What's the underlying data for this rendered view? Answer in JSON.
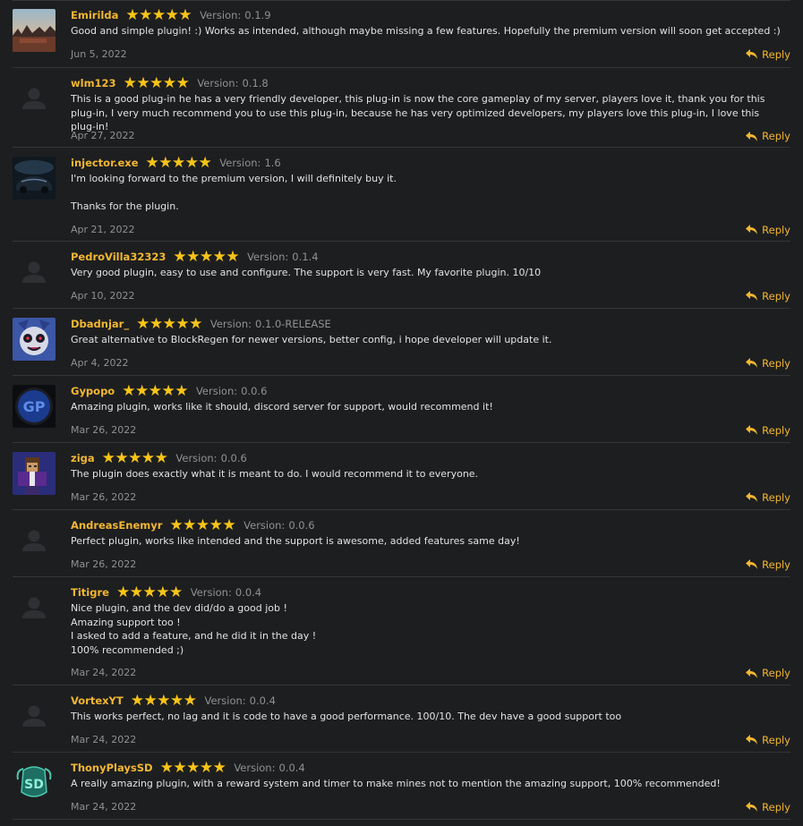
{
  "colors": {
    "background": "#1d1e20",
    "author": "#f2b731",
    "star": "#f7c417",
    "muted": "#8f9193",
    "divider": "#343638"
  },
  "version_label": "Version:",
  "reply_label": "Reply",
  "reviews": [
    {
      "author": "Emirilda",
      "rating": 5,
      "version": "0.1.9",
      "text": "Good and simple plugin! :) Works as intended, although maybe missing a few features. Hopefully the premium version will soon get accepted :)",
      "date": "Jun 5, 2022",
      "avatar": "landscape-photo"
    },
    {
      "author": "wlm123",
      "rating": 5,
      "version": "0.1.8",
      "text": "This is a good plug-in he has a very friendly developer, this plug-in is now the core gameplay of my server, players love it, thank you for this plug-in, I very much recommend you to use this plug-in, because he has very optimized developers, my players love this plug-in, I love this plug-in!",
      "date": "Apr 27, 2022",
      "avatar": "default-user"
    },
    {
      "author": "injector.exe",
      "rating": 5,
      "version": "1.6",
      "text": "I'm looking forward to the premium version, I will definitely buy it.\n\nThanks for the plugin.",
      "date": "Apr 21, 2022",
      "avatar": "dark-car"
    },
    {
      "author": "PedroVilla32323",
      "rating": 5,
      "version": "0.1.4",
      "text": "Very good plugin, easy to use and configure. The support is very fast. My favorite plugin. 10/10",
      "date": "Apr 10, 2022",
      "avatar": "default-user"
    },
    {
      "author": "Dbadnjar_",
      "rating": 5,
      "version": "0.1.0-RELEASE",
      "text": "Great alternative to BlockRegen for newer versions, better config, i hope developer will update it.",
      "date": "Apr 4, 2022",
      "avatar": "cartoon-face"
    },
    {
      "author": "Gypopo",
      "rating": 5,
      "version": "0.0.6",
      "text": "Amazing plugin, works like it should, discord server for support, would recommend it!",
      "date": "Mar 26, 2022",
      "avatar": "gp-logo"
    },
    {
      "author": "ziga",
      "rating": 5,
      "version": "0.0.6",
      "text": "The plugin does exactly what it is meant to do. I would recommend it to everyone.",
      "date": "Mar 26, 2022",
      "avatar": "minecraft-skin"
    },
    {
      "author": "AndreasEnemyr",
      "rating": 5,
      "version": "0.0.6",
      "text": "Perfect plugin, works like intended and the support is awesome, added features same day!",
      "date": "Mar 26, 2022",
      "avatar": "default-user"
    },
    {
      "author": "Titigre",
      "rating": 5,
      "version": "0.0.4",
      "text": "Nice plugin, and the dev did/do a good job !\nAmazing support too !\nI asked to add a feature, and he did it in the day !\n100% recommended ;)",
      "date": "Mar 24, 2022",
      "avatar": "default-user"
    },
    {
      "author": "VortexYT",
      "rating": 5,
      "version": "0.0.4",
      "text": "This works perfect, no lag and it is code to have a good performance. 100/10. The dev have a good support too",
      "date": "Mar 24, 2022",
      "avatar": "default-user"
    },
    {
      "author": "ThonyPlaysSD",
      "rating": 5,
      "version": "0.0.4",
      "text": "A really amazing plugin, with a reward system and timer to make mines not to mention the amazing support, 100% recommended!",
      "date": "Mar 24, 2022",
      "avatar": "sd-logo"
    }
  ]
}
